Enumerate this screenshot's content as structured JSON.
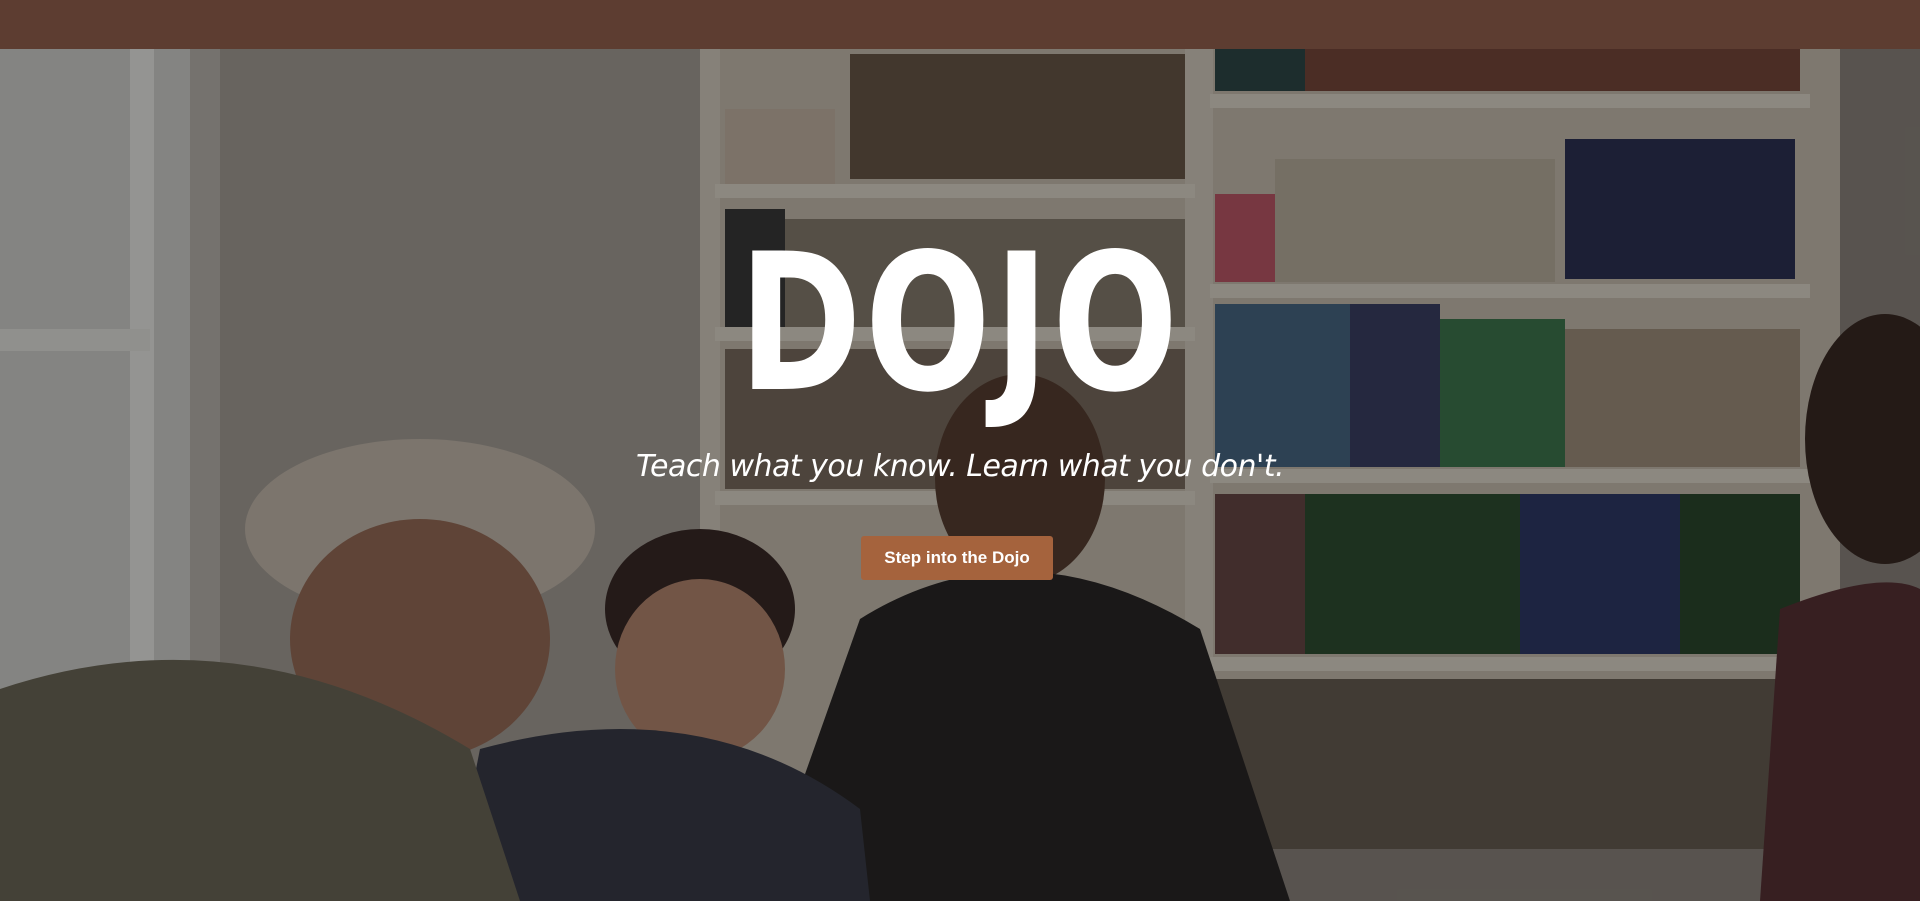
{
  "hero": {
    "title": "DOJO",
    "tagline": "Teach what you know. Learn what you don't.",
    "cta_label": "Step into the Dojo",
    "background_image": "people-laughing-in-library-photo"
  },
  "colors": {
    "topbar": "#5d3d31",
    "cta": "#a5633d",
    "text": "#ffffff"
  }
}
